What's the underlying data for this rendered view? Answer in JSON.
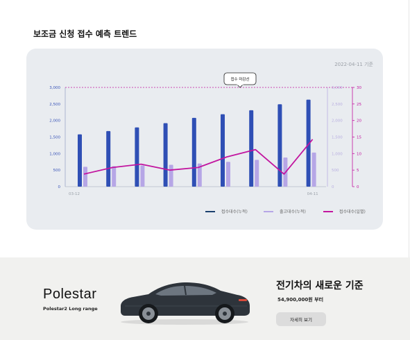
{
  "page": {
    "title": "보조금 신청 접수 예측 트렌드"
  },
  "chart_data": {
    "type": "bar",
    "date_label": "2022-04-11 기준",
    "deadline_label": "접수 마감선",
    "deadline_value": 3000,
    "x_tick_labels": [
      "03-12",
      "04-11"
    ],
    "left_axis": {
      "ylim": [
        0,
        3000
      ],
      "ticks": [
        "0",
        "500",
        "1,000",
        "1,500",
        "2,000",
        "2,500",
        "3,000"
      ],
      "color": "#3a55b8"
    },
    "right_axis_1": {
      "ylim": [
        0,
        3000
      ],
      "ticks": [
        "0",
        "500",
        "1,000",
        "1,500",
        "2,000",
        "2,500",
        "3,000"
      ],
      "color": "#b8aee0"
    },
    "right_axis_2": {
      "ylim": [
        0,
        30
      ],
      "ticks": [
        "0",
        "5",
        "10",
        "15",
        "20",
        "25",
        "30"
      ],
      "color": "#c2159f"
    },
    "series": [
      {
        "name": "접수대수(누적)",
        "type": "bar",
        "axis": "left",
        "color": "#2f4fb5",
        "values": [
          1580,
          1680,
          1790,
          1920,
          2080,
          2190,
          2310,
          2490,
          2630
        ]
      },
      {
        "name": "출고대수(누적)",
        "type": "bar",
        "axis": "right1",
        "color": "#b6a6e6",
        "values": [
          600,
          620,
          640,
          660,
          700,
          750,
          810,
          880,
          1030
        ]
      },
      {
        "name": "접수대수(일별)",
        "type": "line",
        "axis": "right2",
        "color": "#c2159f",
        "values": [
          3.8,
          5.8,
          6.8,
          5.0,
          5.8,
          9.0,
          11.2,
          3.8,
          14.3
        ]
      }
    ],
    "legend_placement": "bottom-right",
    "grid": false
  },
  "ad": {
    "brand": "Polestar",
    "model": "Polestar2 Long range",
    "headline": "전기차의 새로운 기준",
    "price": "54,900,000원 부터",
    "cta_label": "자세히 보기"
  },
  "colors": {
    "card_bg": "#e9ecf0",
    "banner_bg": "#f1f1ef"
  }
}
